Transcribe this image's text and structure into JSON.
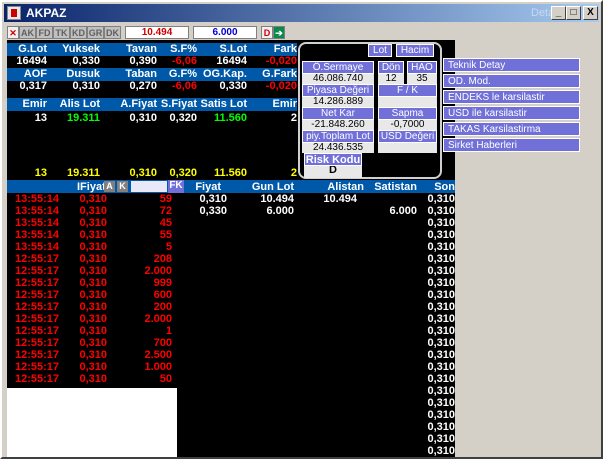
{
  "window": {
    "title": "AKPAZ",
    "detail": "Detay",
    "min": "_",
    "max": "□",
    "close": "X"
  },
  "toolbar": {
    "tabs": [
      "AK",
      "FD",
      "TK",
      "KD",
      "GR",
      "DK"
    ],
    "price": "10.494",
    "qty": "6.000",
    "d_label": "D"
  },
  "summary": {
    "headers1": [
      "G.Lot",
      "Yuksek",
      "Tavan",
      "S.F%",
      "S.Lot",
      "Fark"
    ],
    "row1": [
      "16494",
      "0,330",
      "0,390",
      "-6,06",
      "16494",
      "-0,020"
    ],
    "headers2": [
      "AOF",
      "Dusuk",
      "Taban",
      "G.F%",
      "OG.Kap.",
      "G.Fark"
    ],
    "row2": [
      "0,317",
      "0,310",
      "0,270",
      "-6,06",
      "0,330",
      "-0,020"
    ],
    "headers3": [
      "Emir",
      "Alis Lot",
      "A.Fiyat",
      "S.Fiyat",
      "Satis Lot",
      "Emir"
    ],
    "row3": [
      "13",
      "19.311",
      "0,310",
      "0,320",
      "11.560",
      "2"
    ],
    "row4": [
      "13",
      "19.311",
      "0,310",
      "0,320",
      "11.560",
      "2"
    ]
  },
  "popup": {
    "lot": "Lot",
    "hacim": "Hacim",
    "osermaye": "Ö.Sermaye",
    "osermaye_val": "46.086.740",
    "don": "Dön",
    "don_val": "12",
    "hao": "HAO",
    "hao_val": "35",
    "piyasa": "Piyasa Değeri",
    "piyasa_val": "14.286.889",
    "fk": "F / K",
    "netkar": "Net Kar",
    "netkar_val": "-21.848.260",
    "sapma": "Sapma",
    "sapma_val": "-0,7000",
    "toplam": "piy.Toplam Lot",
    "toplam_val": "24.436.535",
    "usd": "USD Değeri",
    "risk": "Risk Kodu",
    "risk_val": "D"
  },
  "menu": [
    "Teknik Detay",
    "OD. Mod.",
    "ENDEKS le karsilastir",
    "USD ile karsilastir",
    "TAKAS Karsilastirma",
    "Sirket Haberleri"
  ],
  "trades": {
    "headers": {
      "fiyat": "IFiyat",
      "a": "A",
      "k": "K",
      "fk": "FK"
    },
    "rows": [
      [
        "13:55:14",
        "0,310",
        "59"
      ],
      [
        "13:55:14",
        "0,310",
        "72"
      ],
      [
        "13:55:14",
        "0,310",
        "45"
      ],
      [
        "13:55:14",
        "0,310",
        "55"
      ],
      [
        "13:55:14",
        "0,310",
        "5"
      ],
      [
        "12:55:17",
        "0,310",
        "208"
      ],
      [
        "12:55:17",
        "0,310",
        "2.000"
      ],
      [
        "12:55:17",
        "0,310",
        "999"
      ],
      [
        "12:55:17",
        "0,310",
        "600"
      ],
      [
        "12:55:17",
        "0,310",
        "200"
      ],
      [
        "12:55:17",
        "0,310",
        "2.000"
      ],
      [
        "12:55:17",
        "0,310",
        "1"
      ],
      [
        "12:55:17",
        "0,310",
        "700"
      ],
      [
        "12:55:17",
        "0,310",
        "2.500"
      ],
      [
        "12:55:17",
        "0,310",
        "1.000"
      ],
      [
        "12:55:17",
        "0,310",
        "50"
      ]
    ]
  },
  "depth": {
    "headers": [
      "Fiyat",
      "Gun Lot",
      "Alistan",
      "Satistan",
      "Son"
    ],
    "rows": [
      [
        "0,310",
        "10.494",
        "10.494",
        "",
        "0,310"
      ],
      [
        "0,330",
        "6.000",
        "",
        "6.000",
        "0,310"
      ]
    ],
    "son_tail": "0,310"
  }
}
